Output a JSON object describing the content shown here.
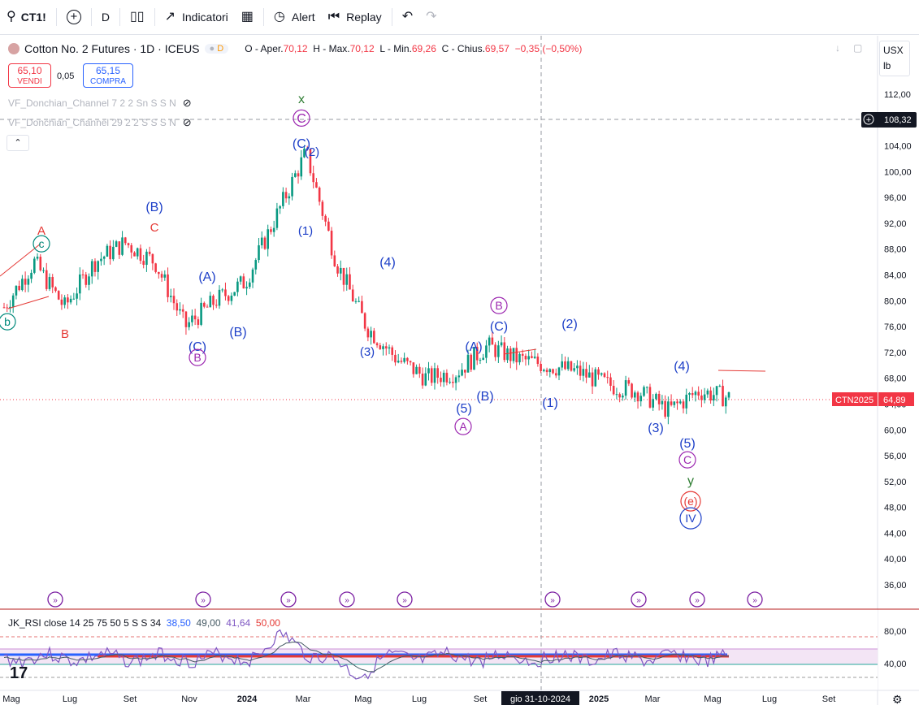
{
  "toolbar": {
    "symbol": "CT1!",
    "interval": "D",
    "indicators_label": "Indicatori",
    "alert_label": "Alert",
    "replay_label": "Replay"
  },
  "legend": {
    "title": "Cotton No. 2 Futures · 1D · ICEUS",
    "mode": "D",
    "o_label": "O - Aper.",
    "o_value": "70,12",
    "h_label": "H - Max.",
    "h_value": "70,12",
    "l_label": "L - Min.",
    "l_value": "69,26",
    "c_label": "C - Chius.",
    "c_value": "69,57",
    "change": "−0,35 (−0,50%)"
  },
  "trade": {
    "sell_price": "65,10",
    "sell_label": "VENDI",
    "spread": "0,05",
    "buy_price": "65,15",
    "buy_label": "COMPRA"
  },
  "indicators": [
    {
      "label": "VF_Donchian_Channel 7 2 2 Sn S S N"
    },
    {
      "label": "VF_Donchian_Channel 29 2 2 S S S N"
    }
  ],
  "currency": {
    "unit": "USX",
    "sub": "lb"
  },
  "price_axis": {
    "ticks": [
      "112,00",
      "108,00",
      "104,00",
      "100,00",
      "96,00",
      "92,00",
      "88,00",
      "84,00",
      "80,00",
      "76,00",
      "72,00",
      "68,00",
      "64,00",
      "60,00",
      "56,00",
      "52,00",
      "48,00",
      "44,00",
      "40,00",
      "36,00"
    ],
    "crosshair_label": "108,32",
    "last_symbol": "CTN2025",
    "last_price": "64,89"
  },
  "time_axis": {
    "ticks": [
      "Mag",
      "Lug",
      "Set",
      "Nov",
      "2024",
      "Mar",
      "Mag",
      "Lug",
      "Set",
      "2025",
      "Mar",
      "Mag",
      "Lug",
      "Set"
    ],
    "crosshair_label": "gio 31-10-2024"
  },
  "rsi": {
    "name": "JK_RSI close 14 25 75 50 5 S S 34",
    "v1": "38,50",
    "v2": "49,00",
    "v3": "41,64",
    "v4": "50,00",
    "ticks": [
      "80,00",
      "40,00"
    ]
  },
  "wave_labels": [
    {
      "text": "x",
      "color": "#2e7d32"
    },
    {
      "text": "C",
      "color": "#9c27b0",
      "circled": true
    },
    {
      "text": "(C)",
      "color": "#1e40c8"
    },
    {
      "text": "(2)",
      "color": "#1e40c8"
    },
    {
      "text": "(1)",
      "color": "#1e40c8"
    },
    {
      "text": "(B)",
      "color": "#1e40c8"
    },
    {
      "text": "C",
      "color": "#e53935"
    },
    {
      "text": "A",
      "color": "#e53935"
    },
    {
      "text": "c",
      "color": "#00897b",
      "circled": true
    },
    {
      "text": "b",
      "color": "#00897b",
      "circled": true
    },
    {
      "text": "B",
      "color": "#e53935"
    },
    {
      "text": "(A)",
      "color": "#1e40c8"
    },
    {
      "text": "(C)",
      "color": "#1e40c8"
    },
    {
      "text": "B",
      "color": "#9c27b0",
      "circled": true
    },
    {
      "text": "(B)",
      "color": "#1e40c8"
    },
    {
      "text": "(4)",
      "color": "#1e40c8"
    },
    {
      "text": "(3)",
      "color": "#1e40c8"
    },
    {
      "text": "(A)",
      "color": "#1e40c8"
    },
    {
      "text": "(5)",
      "color": "#1e40c8"
    },
    {
      "text": "A",
      "color": "#9c27b0",
      "circled": true
    },
    {
      "text": "(B)",
      "color": "#1e40c8"
    },
    {
      "text": "B",
      "color": "#9c27b0",
      "circled": true
    },
    {
      "text": "(C)",
      "color": "#1e40c8"
    },
    {
      "text": "(2)",
      "color": "#1e40c8"
    },
    {
      "text": "(1)",
      "color": "#1e40c8"
    },
    {
      "text": "(3)",
      "color": "#1e40c8"
    },
    {
      "text": "(4)",
      "color": "#1e40c8"
    },
    {
      "text": "(5)",
      "color": "#1e40c8"
    },
    {
      "text": "C",
      "color": "#9c27b0",
      "circled": true
    },
    {
      "text": "y",
      "color": "#2e7d32"
    },
    {
      "text": "(e)",
      "color": "#e53935",
      "circled": true
    },
    {
      "text": "IV",
      "color": "#1e40c8",
      "circled": true
    }
  ],
  "colors": {
    "candle_up": "#089981",
    "candle_down": "#f23645",
    "wave_blue": "#1e40c8",
    "wave_purple": "#9c27b0",
    "wave_red": "#e53935",
    "wave_green": "#2e7d32"
  },
  "chart_data": {
    "type": "candlestick",
    "price_series_approx": [
      {
        "x": "2023-05",
        "y": 79
      },
      {
        "x": "2023-06",
        "y": 86
      },
      {
        "x": "2023-07",
        "y": 79
      },
      {
        "x": "2023-08",
        "y": 86
      },
      {
        "x": "2023-09",
        "y": 89
      },
      {
        "x": "2023-10",
        "y": 86
      },
      {
        "x": "2023-11",
        "y": 76
      },
      {
        "x": "2023-12",
        "y": 80
      },
      {
        "x": "2024-01",
        "y": 83
      },
      {
        "x": "2024-02",
        "y": 93
      },
      {
        "x": "2024-03",
        "y": 103
      },
      {
        "x": "2024-04",
        "y": 86
      },
      {
        "x": "2024-05",
        "y": 76
      },
      {
        "x": "2024-06",
        "y": 71
      },
      {
        "x": "2024-07",
        "y": 68
      },
      {
        "x": "2024-08",
        "y": 69
      },
      {
        "x": "2024-09",
        "y": 73
      },
      {
        "x": "2024-10",
        "y": 71
      },
      {
        "x": "2024-11",
        "y": 70
      },
      {
        "x": "2024-12",
        "y": 69
      },
      {
        "x": "2025-01",
        "y": 67
      },
      {
        "x": "2025-02",
        "y": 66
      },
      {
        "x": "2025-03",
        "y": 63
      },
      {
        "x": "2025-04",
        "y": 66
      },
      {
        "x": "2025-05",
        "y": 65
      }
    ],
    "ylim": [
      34,
      114
    ]
  }
}
